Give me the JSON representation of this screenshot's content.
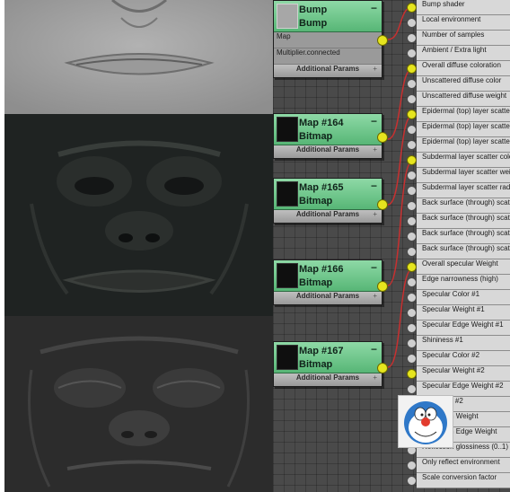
{
  "textures": [
    {
      "name": "bump-texture"
    },
    {
      "name": "map-164-texture"
    },
    {
      "name": "map-165-texture"
    }
  ],
  "nodes": [
    {
      "title": "Bump",
      "type": "Bump",
      "rows": [
        "Map",
        "Multiplier.connected"
      ],
      "footer": "Additional Params",
      "collapse": "−",
      "expand": "+"
    },
    {
      "title": "Map #164",
      "type": "Bitmap",
      "rows": [],
      "footer": "Additional Params",
      "collapse": "−",
      "expand": "+"
    },
    {
      "title": "Map #165",
      "type": "Bitmap",
      "rows": [],
      "footer": "Additional Params",
      "collapse": "−",
      "expand": "+"
    },
    {
      "title": "Map #166",
      "type": "Bitmap",
      "rows": [],
      "footer": "Additional Params",
      "collapse": "−",
      "expand": "+"
    },
    {
      "title": "Map #167",
      "type": "Bitmap",
      "rows": [],
      "footer": "Additional Params",
      "collapse": "−",
      "expand": "+"
    }
  ],
  "params": [
    {
      "label": "Bump shader",
      "connected": true
    },
    {
      "label": "Local environment",
      "connected": false
    },
    {
      "label": "Number of samples",
      "connected": false
    },
    {
      "label": "Ambient / Extra light",
      "connected": false
    },
    {
      "label": "Overall diffuse coloration",
      "connected": true
    },
    {
      "label": "Unscattered diffuse color",
      "connected": false
    },
    {
      "label": "Unscattered diffuse weight",
      "connected": false
    },
    {
      "label": "Epidermal (top) layer scatter color",
      "connected": true
    },
    {
      "label": "Epidermal (top) layer scatter weight",
      "connected": false
    },
    {
      "label": "Epidermal (top) layer scatter radius",
      "connected": false
    },
    {
      "label": "Subdermal layer scatter color",
      "connected": true
    },
    {
      "label": "Subdermal layer scatter weight",
      "connected": false
    },
    {
      "label": "Subdermal layer scatter radius",
      "connected": false
    },
    {
      "label": "Back surface (through) scatter color",
      "connected": false
    },
    {
      "label": "Back surface (through) scatter weight",
      "connected": false
    },
    {
      "label": "Back surface (through) scatter radius",
      "connected": false
    },
    {
      "label": "Back surface (through) scatter depth",
      "connected": false
    },
    {
      "label": "Overall specular Weight",
      "connected": true
    },
    {
      "label": "Edge narrowness (high)",
      "connected": false
    },
    {
      "label": "Specular Color #1",
      "connected": false
    },
    {
      "label": "Specular Weight #1",
      "connected": false
    },
    {
      "label": "Specular Edge Weight #1",
      "connected": false
    },
    {
      "label": "Shininess #1",
      "connected": false
    },
    {
      "label": "Specular Color #2",
      "connected": false
    },
    {
      "label": "Specular Weight #2",
      "connected": true
    },
    {
      "label": "Specular Edge Weight #2",
      "connected": false
    },
    {
      "label": "Shininess #2",
      "connected": false
    },
    {
      "label": "Reflection Weight",
      "connected": false
    },
    {
      "label": "Reflection Edge Weight",
      "connected": false
    },
    {
      "label": "Reflection glossiness (0..1)",
      "connected": false
    },
    {
      "label": "Only reflect environment",
      "connected": false
    },
    {
      "label": "Scale conversion factor",
      "connected": false
    }
  ],
  "colors": {
    "node_header": "#57b676",
    "socket_connected": "#e6e51e",
    "wire": "#c83030",
    "canvas": "#4a4a4a"
  }
}
